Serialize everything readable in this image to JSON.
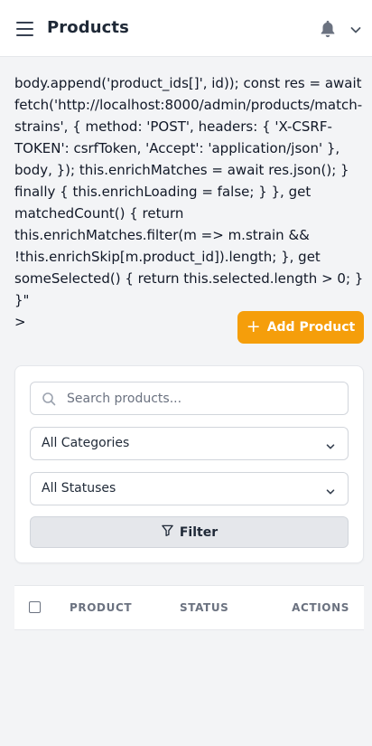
{
  "header": {
    "title": "Products",
    "menu_icon": "hamburger-menu-icon",
    "notification_icon": "bell-icon",
    "account_icon": "chevron-down-icon"
  },
  "leaked_code": "body.append('product_ids[]', id)); const res = await fetch('http://localhost:8000/admin/products/match-strains', { method: 'POST', headers: { 'X-CSRF-TOKEN': csrfToken, 'Accept': 'application/json' }, body, }); this.enrichMatches = await res.json(); } finally { this.enrichLoading = false; } }, get matchedCount() { return this.enrichMatches.filter(m => m.strain && !this.enrichSkip[m.product_id]).length; }, get someSelected() { return this.selected.length > 0; } }\"\n>",
  "actions": {
    "add_product_label": "Add Product",
    "add_product_icon": "plus-icon"
  },
  "filters": {
    "search_placeholder": "Search products...",
    "search_value": "",
    "category_selected": "All Categories",
    "status_selected": "All Statuses",
    "filter_button_label": "Filter",
    "filter_icon": "funnel-icon"
  },
  "table": {
    "columns": [
      "PRODUCT",
      "STATUS",
      "ACTIONS"
    ]
  },
  "colors": {
    "accent": "#f59e0b",
    "background": "#f3f4f6"
  }
}
